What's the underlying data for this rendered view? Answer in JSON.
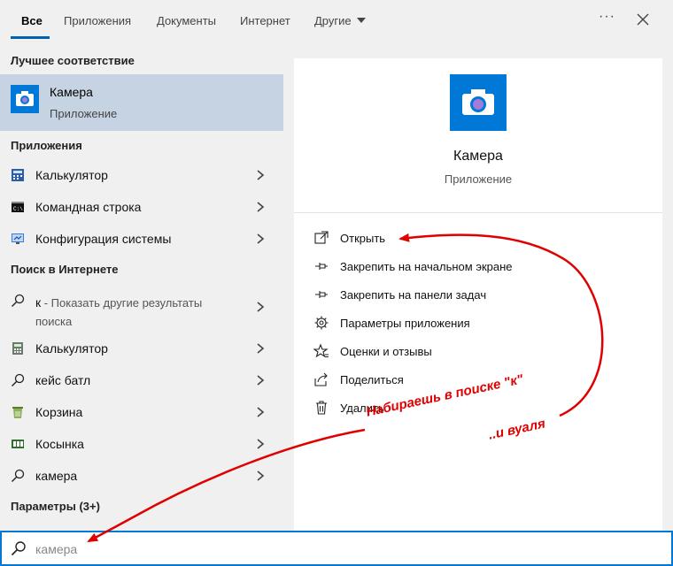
{
  "tabs": [
    {
      "label": "Все",
      "active": true
    },
    {
      "label": "Приложения"
    },
    {
      "label": "Документы"
    },
    {
      "label": "Интернет"
    },
    {
      "label": "Другие"
    }
  ],
  "toolbar": {
    "more_icon": "more-icon",
    "close_icon": "close-icon"
  },
  "sections": {
    "best_match": "Лучшее соответствие",
    "apps": "Приложения",
    "web_search": "Поиск в Интернете",
    "settings": "Параметры (3+)"
  },
  "best_match": {
    "name": "Камера",
    "type": "Приложение",
    "icon": "camera-icon"
  },
  "apps": [
    {
      "label": "Калькулятор",
      "icon": "calculator-icon"
    },
    {
      "label": "Командная строка",
      "icon": "command-prompt-icon"
    },
    {
      "label": "Конфигурация системы",
      "icon": "system-config-icon"
    }
  ],
  "web": {
    "query": "к",
    "suffix": " - Показать другие результаты поиска",
    "items": [
      {
        "label": "Калькулятор",
        "icon": "calculator-icon"
      },
      {
        "label": "кейс батл",
        "icon": "search-icon"
      },
      {
        "label": "Корзина",
        "icon": "recycle-bin-icon"
      },
      {
        "label": "Косынка",
        "icon": "solitaire-icon"
      },
      {
        "label": "камера",
        "icon": "search-icon"
      }
    ]
  },
  "details": {
    "title": "Камера",
    "subtitle": "Приложение",
    "actions": [
      {
        "label": "Открыть",
        "icon": "open-icon"
      },
      {
        "label": "Закрепить на начальном экране",
        "icon": "pin-icon"
      },
      {
        "label": "Закрепить на панели задач",
        "icon": "pin-icon"
      },
      {
        "label": "Параметры приложения",
        "icon": "gear-icon"
      },
      {
        "label": "Оценки и отзывы",
        "icon": "star-icon"
      },
      {
        "label": "Поделиться",
        "icon": "share-icon"
      },
      {
        "label": "Удалить",
        "icon": "trash-icon"
      }
    ]
  },
  "search": {
    "value": "камера"
  },
  "annotations": {
    "line1": "Набираешь в поиске \"к\"",
    "line2": "..и вуаля"
  },
  "colors": {
    "accent": "#0078d7",
    "selected_bg": "#c6d3e2",
    "annotation": "#e00000"
  }
}
